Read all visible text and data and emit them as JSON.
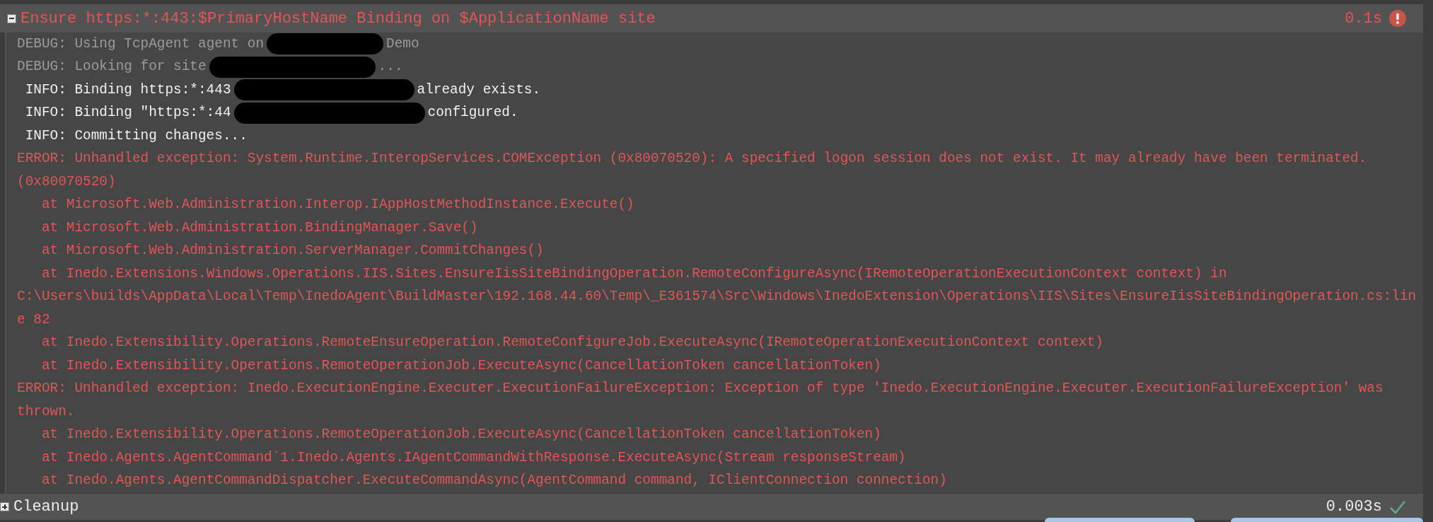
{
  "operation": {
    "title": "Ensure https:*:443:$PrimaryHostName Binding on $ApplicationName site",
    "expanded": true,
    "duration": "0.1s",
    "failed": true
  },
  "log": [
    {
      "kind": "debug",
      "text": "DEBUG: Using TcpAgent agent on",
      "redacted": true,
      "after": "Demo"
    },
    {
      "kind": "debug",
      "text": "DEBUG: Looking for site",
      "redacted": true,
      "after": "..."
    },
    {
      "kind": "info",
      "text": "INFO: Binding https:*:443",
      "redacted": true,
      "after": "already exists."
    },
    {
      "kind": "info",
      "text": "INFO: Binding \"https:*:44",
      "redacted": true,
      "after": "configured."
    },
    {
      "kind": "info",
      "text": "INFO: Committing changes..."
    },
    {
      "kind": "error",
      "text": "ERROR: Unhandled exception: System.Runtime.InteropServices.COMException (0x80070520): A specified logon session does not exist. It may already have been terminated."
    },
    {
      "kind": "error",
      "text": "(0x80070520)"
    },
    {
      "kind": "frame",
      "text": "at Microsoft.Web.Administration.Interop.IAppHostMethodInstance.Execute()"
    },
    {
      "kind": "frame",
      "text": "at Microsoft.Web.Administration.BindingManager.Save()"
    },
    {
      "kind": "frame",
      "text": "at Microsoft.Web.Administration.ServerManager.CommitChanges()"
    },
    {
      "kind": "frame",
      "text": "at Inedo.Extensions.Windows.Operations.IIS.Sites.EnsureIisSiteBindingOperation.RemoteConfigureAsync(IRemoteOperationExecutionContext context) in"
    },
    {
      "kind": "error",
      "text": "C:\\Users\\builds\\AppData\\Local\\Temp\\InedoAgent\\BuildMaster\\192.168.44.60\\Temp\\_E361574\\Src\\Windows\\InedoExtension\\Operations\\IIS\\Sites\\EnsureIisSiteBindingOperation.cs:lin"
    },
    {
      "kind": "error",
      "text": "e 82"
    },
    {
      "kind": "frame",
      "text": "at Inedo.Extensibility.Operations.RemoteEnsureOperation.RemoteConfigureJob.ExecuteAsync(IRemoteOperationExecutionContext context)"
    },
    {
      "kind": "frame",
      "text": "at Inedo.Extensibility.Operations.RemoteOperationJob.ExecuteAsync(CancellationToken cancellationToken)"
    },
    {
      "kind": "error",
      "text": "ERROR: Unhandled exception: Inedo.ExecutionEngine.Executer.ExecutionFailureException: Exception of type 'Inedo.ExecutionEngine.Executer.ExecutionFailureException' was"
    },
    {
      "kind": "error",
      "text": "thrown."
    },
    {
      "kind": "frame",
      "text": "at Inedo.Extensibility.Operations.RemoteOperationJob.ExecuteAsync(CancellationToken cancellationToken)"
    },
    {
      "kind": "frame",
      "text": "at Inedo.Agents.AgentCommand`1.Inedo.Agents.IAgentCommandWithResponse.ExecuteAsync(Stream responseStream)"
    },
    {
      "kind": "frame",
      "text": "at Inedo.Agents.AgentCommandDispatcher.ExecuteCommandAsync(AgentCommand command, IClientConnection connection)"
    }
  ],
  "next_operation": {
    "title": "Cleanup",
    "expanded": false,
    "duration": "0.003s",
    "failed": false
  }
}
